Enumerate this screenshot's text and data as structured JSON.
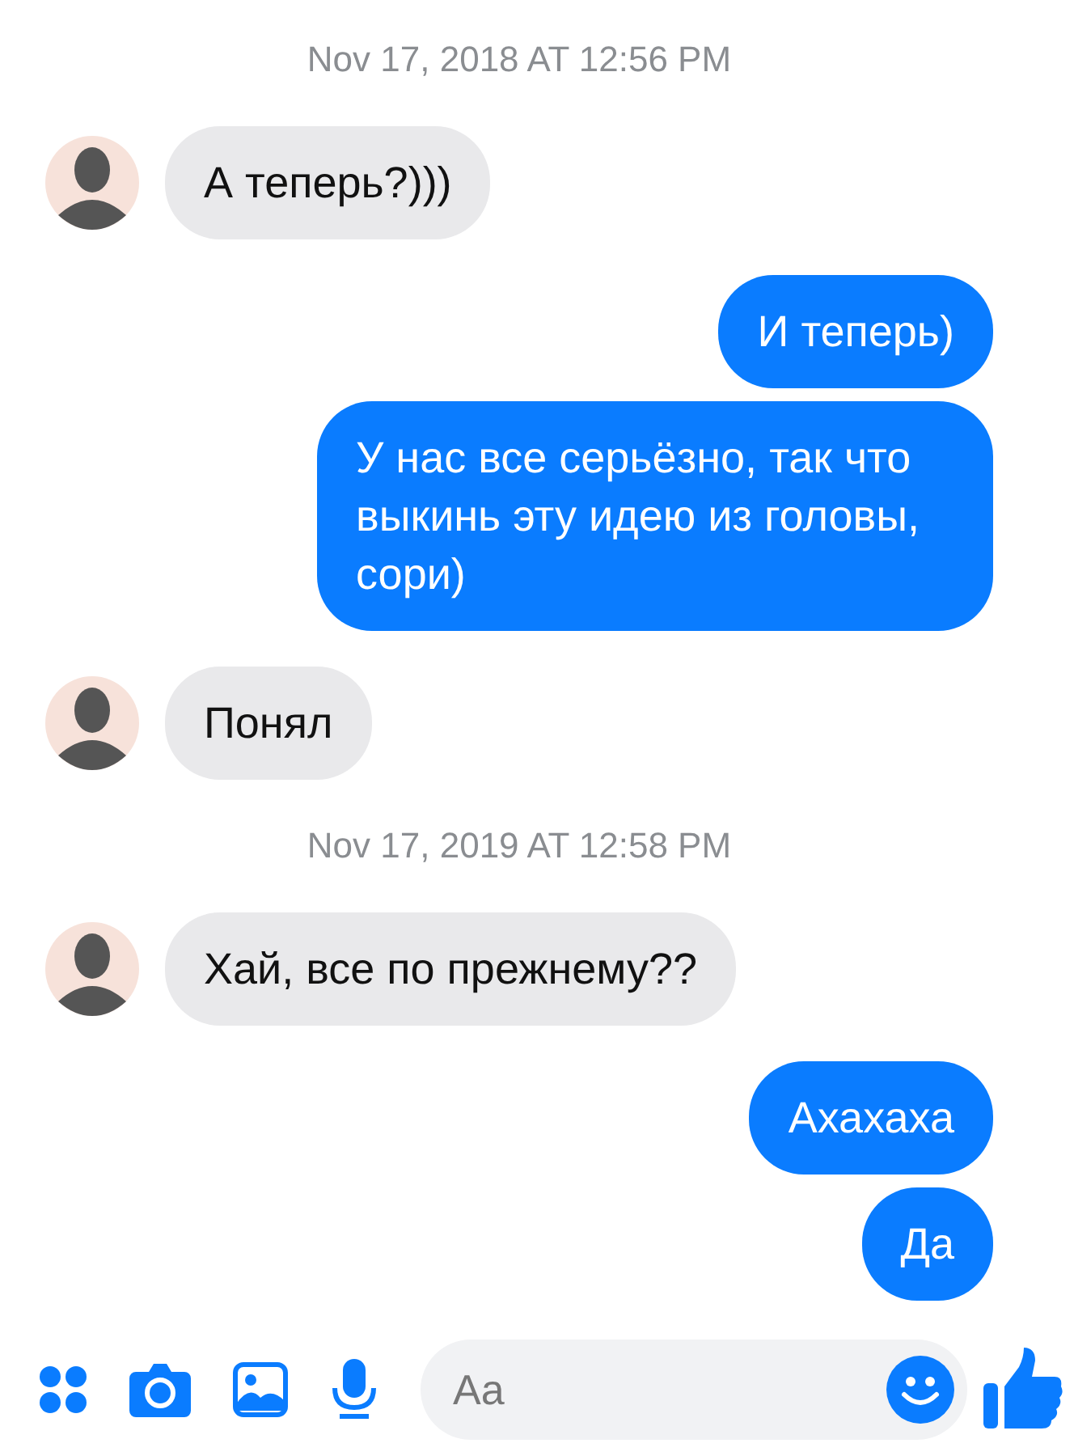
{
  "messages": [
    {
      "kind": "timestamp",
      "text": "Nov 17, 2018 AT 12:56 PM"
    },
    {
      "kind": "incoming",
      "text": "А теперь?)))"
    },
    {
      "kind": "outgoing",
      "text": "И теперь)"
    },
    {
      "kind": "outgoing",
      "text": "У нас все серьёзно, так что выкинь эту идею из головы, сори)"
    },
    {
      "kind": "incoming",
      "text": "Понял"
    },
    {
      "kind": "timestamp",
      "text": "Nov 17, 2019 AT 12:58 PM"
    },
    {
      "kind": "incoming",
      "text": "Хай, все по прежнему??"
    },
    {
      "kind": "outgoing",
      "text": "Ахахаха"
    },
    {
      "kind": "outgoing",
      "text": "Да"
    }
  ],
  "composer": {
    "placeholder": "Aa"
  }
}
